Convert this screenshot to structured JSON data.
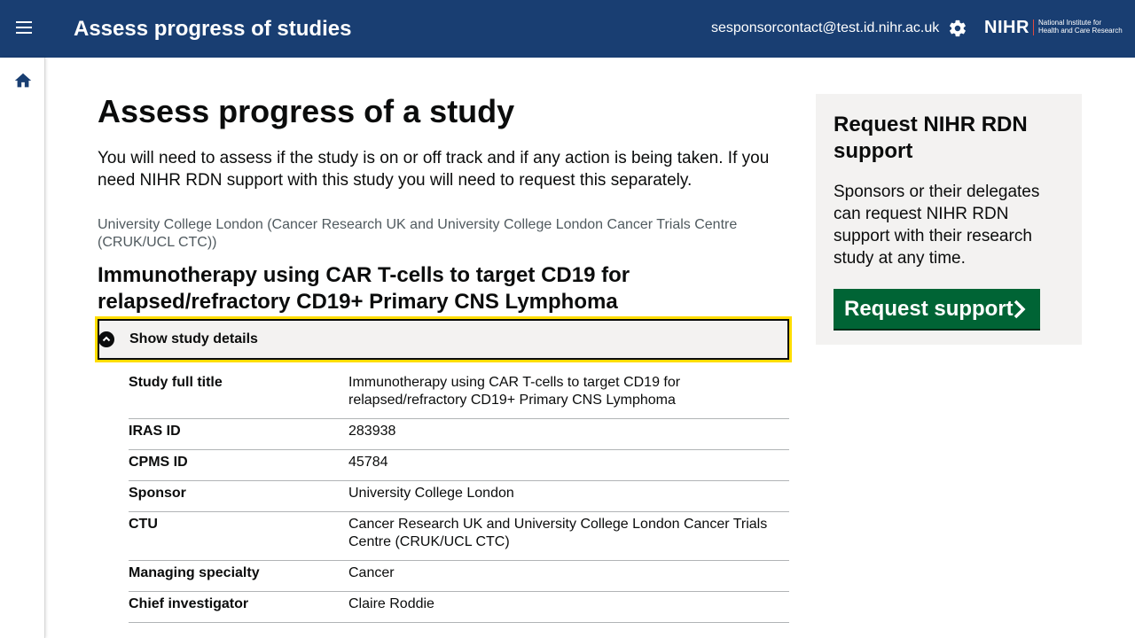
{
  "header": {
    "app_title": "Assess progress of studies",
    "user_email": "sesponsorcontact@test.id.nihr.ac.uk",
    "logo_main": "NIHR",
    "logo_sub_line1": "National Institute for",
    "logo_sub_line2": "Health and Care Research",
    "menu_icon": "hamburger-menu-icon",
    "settings_icon": "gear-icon"
  },
  "sidebar": {
    "home_icon": "home-icon"
  },
  "main": {
    "page_title": "Assess progress of a study",
    "intro": "You will need to assess if the study is on or off track and if any action is being taken. If you need NIHR RDN support with this study you will need to request this separately.",
    "organisation": "University College London (Cancer Research UK and University College London Cancer Trials Centre (CRUK/UCL CTC))",
    "study_title": "Immunotherapy using CAR T-cells to target CD19 for relapsed/refractory CD19+ Primary CNS Lymphoma",
    "details_toggle_label": "Show study details",
    "details": [
      {
        "key": "Study full title",
        "value": "Immunotherapy using CAR T-cells to target CD19 for relapsed/refractory CD19+ Primary CNS Lymphoma"
      },
      {
        "key": "IRAS ID",
        "value": "283938"
      },
      {
        "key": "CPMS ID",
        "value": "45784"
      },
      {
        "key": "Sponsor",
        "value": "University College London"
      },
      {
        "key": "CTU",
        "value": "Cancer Research UK and University College London Cancer Trials Centre (CRUK/UCL CTC)"
      },
      {
        "key": "Managing specialty",
        "value": "Cancer"
      },
      {
        "key": "Chief investigator",
        "value": "Claire Roddie"
      }
    ]
  },
  "aside": {
    "title": "Request NIHR RDN support",
    "text": "Sponsors or their delegates can request NIHR RDN support with their research study at any time.",
    "button_label": "Request support"
  },
  "colors": {
    "header_bg": "#193e72",
    "focus_outline": "#ffdd00",
    "button_green": "#006435",
    "panel_bg": "#f3f2f1"
  }
}
